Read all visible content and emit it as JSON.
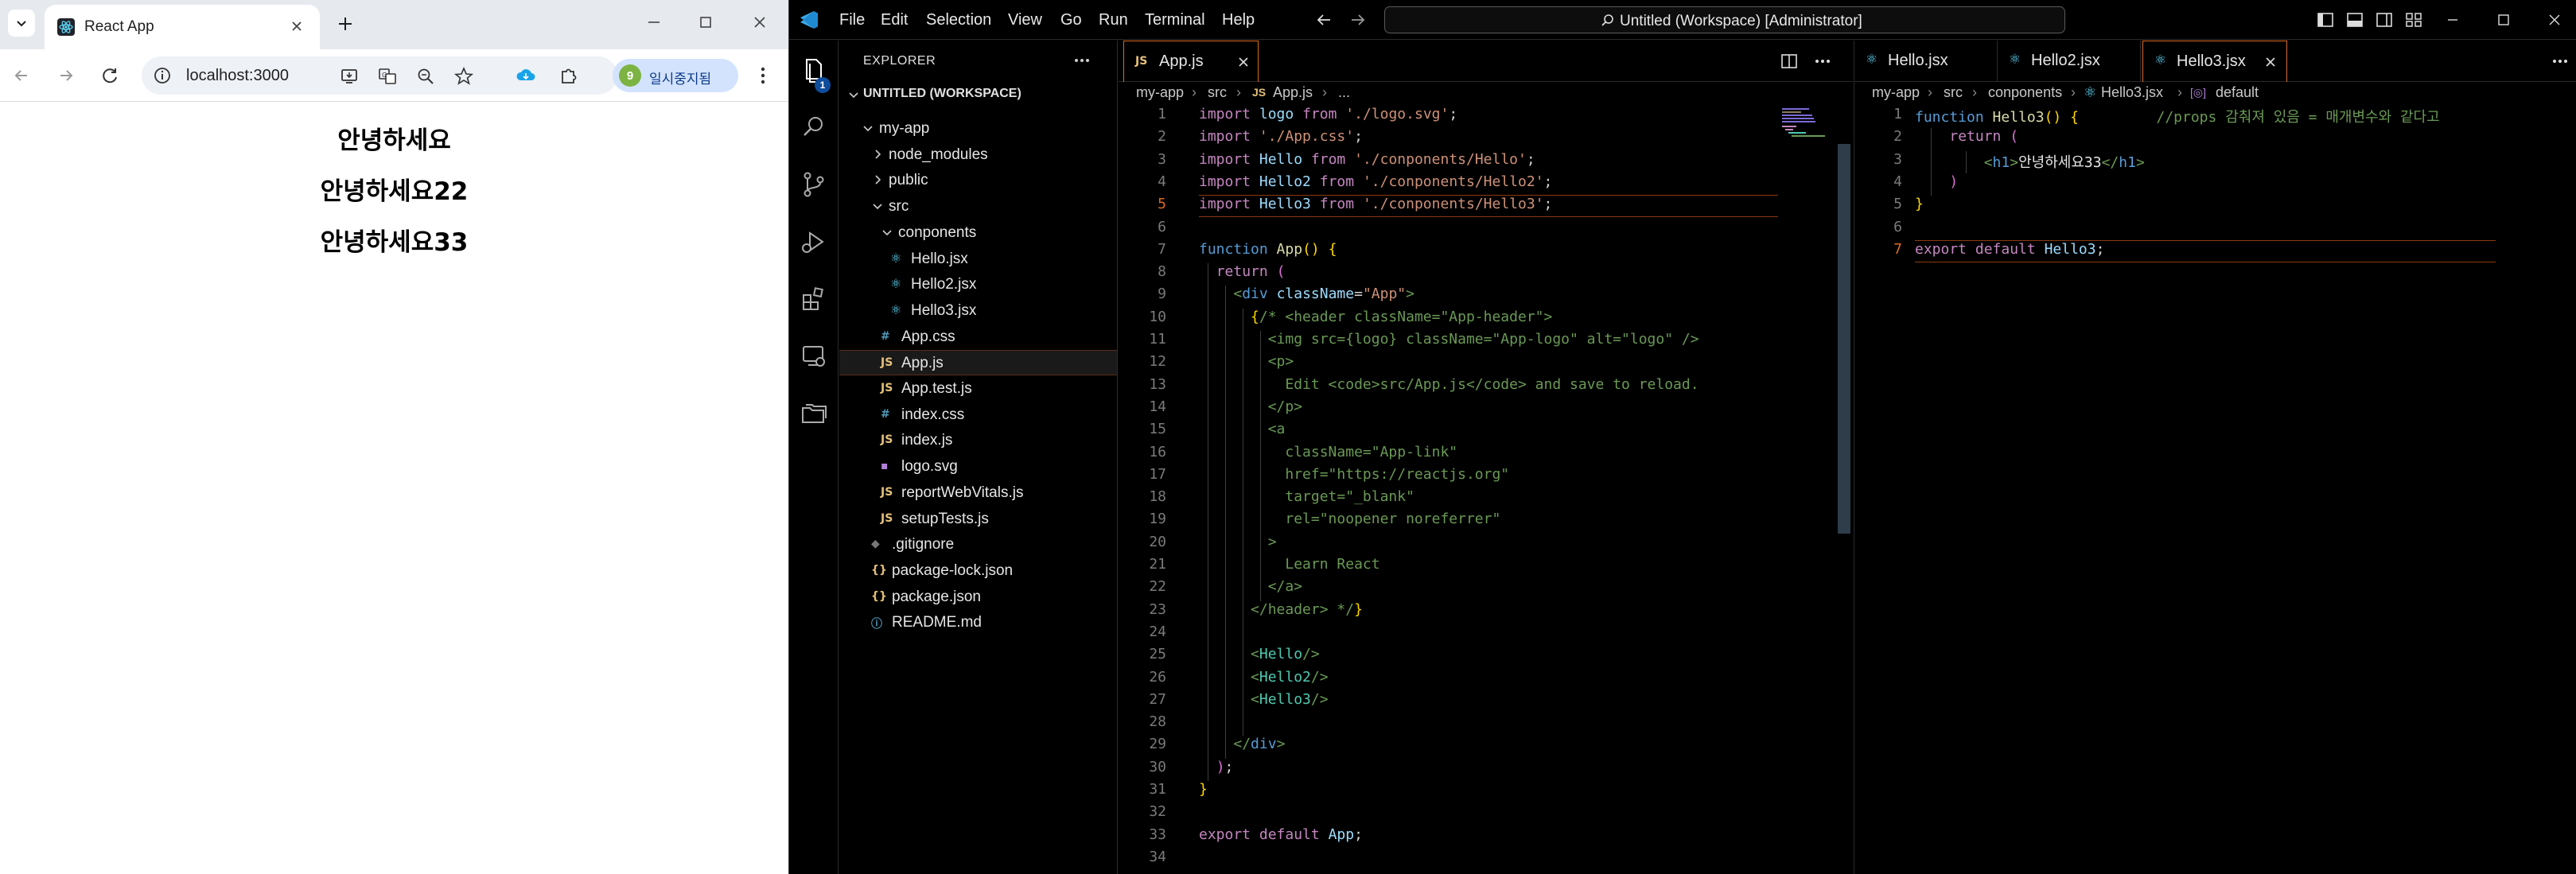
{
  "browser": {
    "tab_title": "React App",
    "url": "localhost:3000",
    "profile_label": "일시중지됨",
    "profile_initial": "9",
    "page_headings": [
      "안녕하세요",
      "안녕하세요22",
      "안녕하세요33"
    ]
  },
  "vscode": {
    "menu": [
      "File",
      "Edit",
      "Selection",
      "View",
      "Go",
      "Run",
      "Terminal",
      "Help"
    ],
    "command_center": "Untitled (Workspace) [Administrator]",
    "activity_badge": "1",
    "explorer_title": "EXPLORER",
    "workspace_title": "UNTITLED (WORKSPACE)",
    "tree": [
      {
        "label": "my-app",
        "type": "folder-open"
      },
      {
        "label": "node_modules",
        "type": "folder"
      },
      {
        "label": "public",
        "type": "folder"
      },
      {
        "label": "src",
        "type": "folder-open"
      },
      {
        "label": "conponents",
        "type": "folder-open"
      },
      {
        "label": "Hello.jsx",
        "type": "react"
      },
      {
        "label": "Hello2.jsx",
        "type": "react"
      },
      {
        "label": "Hello3.jsx",
        "type": "react"
      },
      {
        "label": "App.css",
        "type": "css"
      },
      {
        "label": "App.js",
        "type": "js"
      },
      {
        "label": "App.test.js",
        "type": "js"
      },
      {
        "label": "index.css",
        "type": "css"
      },
      {
        "label": "index.js",
        "type": "js"
      },
      {
        "label": "logo.svg",
        "type": "svg"
      },
      {
        "label": "reportWebVitals.js",
        "type": "js"
      },
      {
        "label": "setupTests.js",
        "type": "js"
      },
      {
        "label": ".gitignore",
        "type": "git"
      },
      {
        "label": "package-lock.json",
        "type": "json"
      },
      {
        "label": "package.json",
        "type": "json"
      },
      {
        "label": "README.md",
        "type": "info"
      }
    ],
    "left_group": {
      "tabs": [
        {
          "label": "App.js",
          "icon": "JS"
        }
      ],
      "breadcrumb": [
        "my-app",
        "src",
        "App.js",
        "..."
      ],
      "current_line": 5
    },
    "right_group": {
      "tabs": [
        {
          "label": "Hello.jsx"
        },
        {
          "label": "Hello2.jsx"
        },
        {
          "label": "Hello3.jsx"
        }
      ],
      "breadcrumb": [
        "my-app",
        "src",
        "conponents",
        "Hello3.jsx",
        "default"
      ],
      "current_line": 7
    },
    "icon_labels": {
      "js": "JS",
      "css": "#",
      "json": "{}",
      "info": "ⓘ",
      "git": "◆",
      "svg": "▪"
    }
  }
}
